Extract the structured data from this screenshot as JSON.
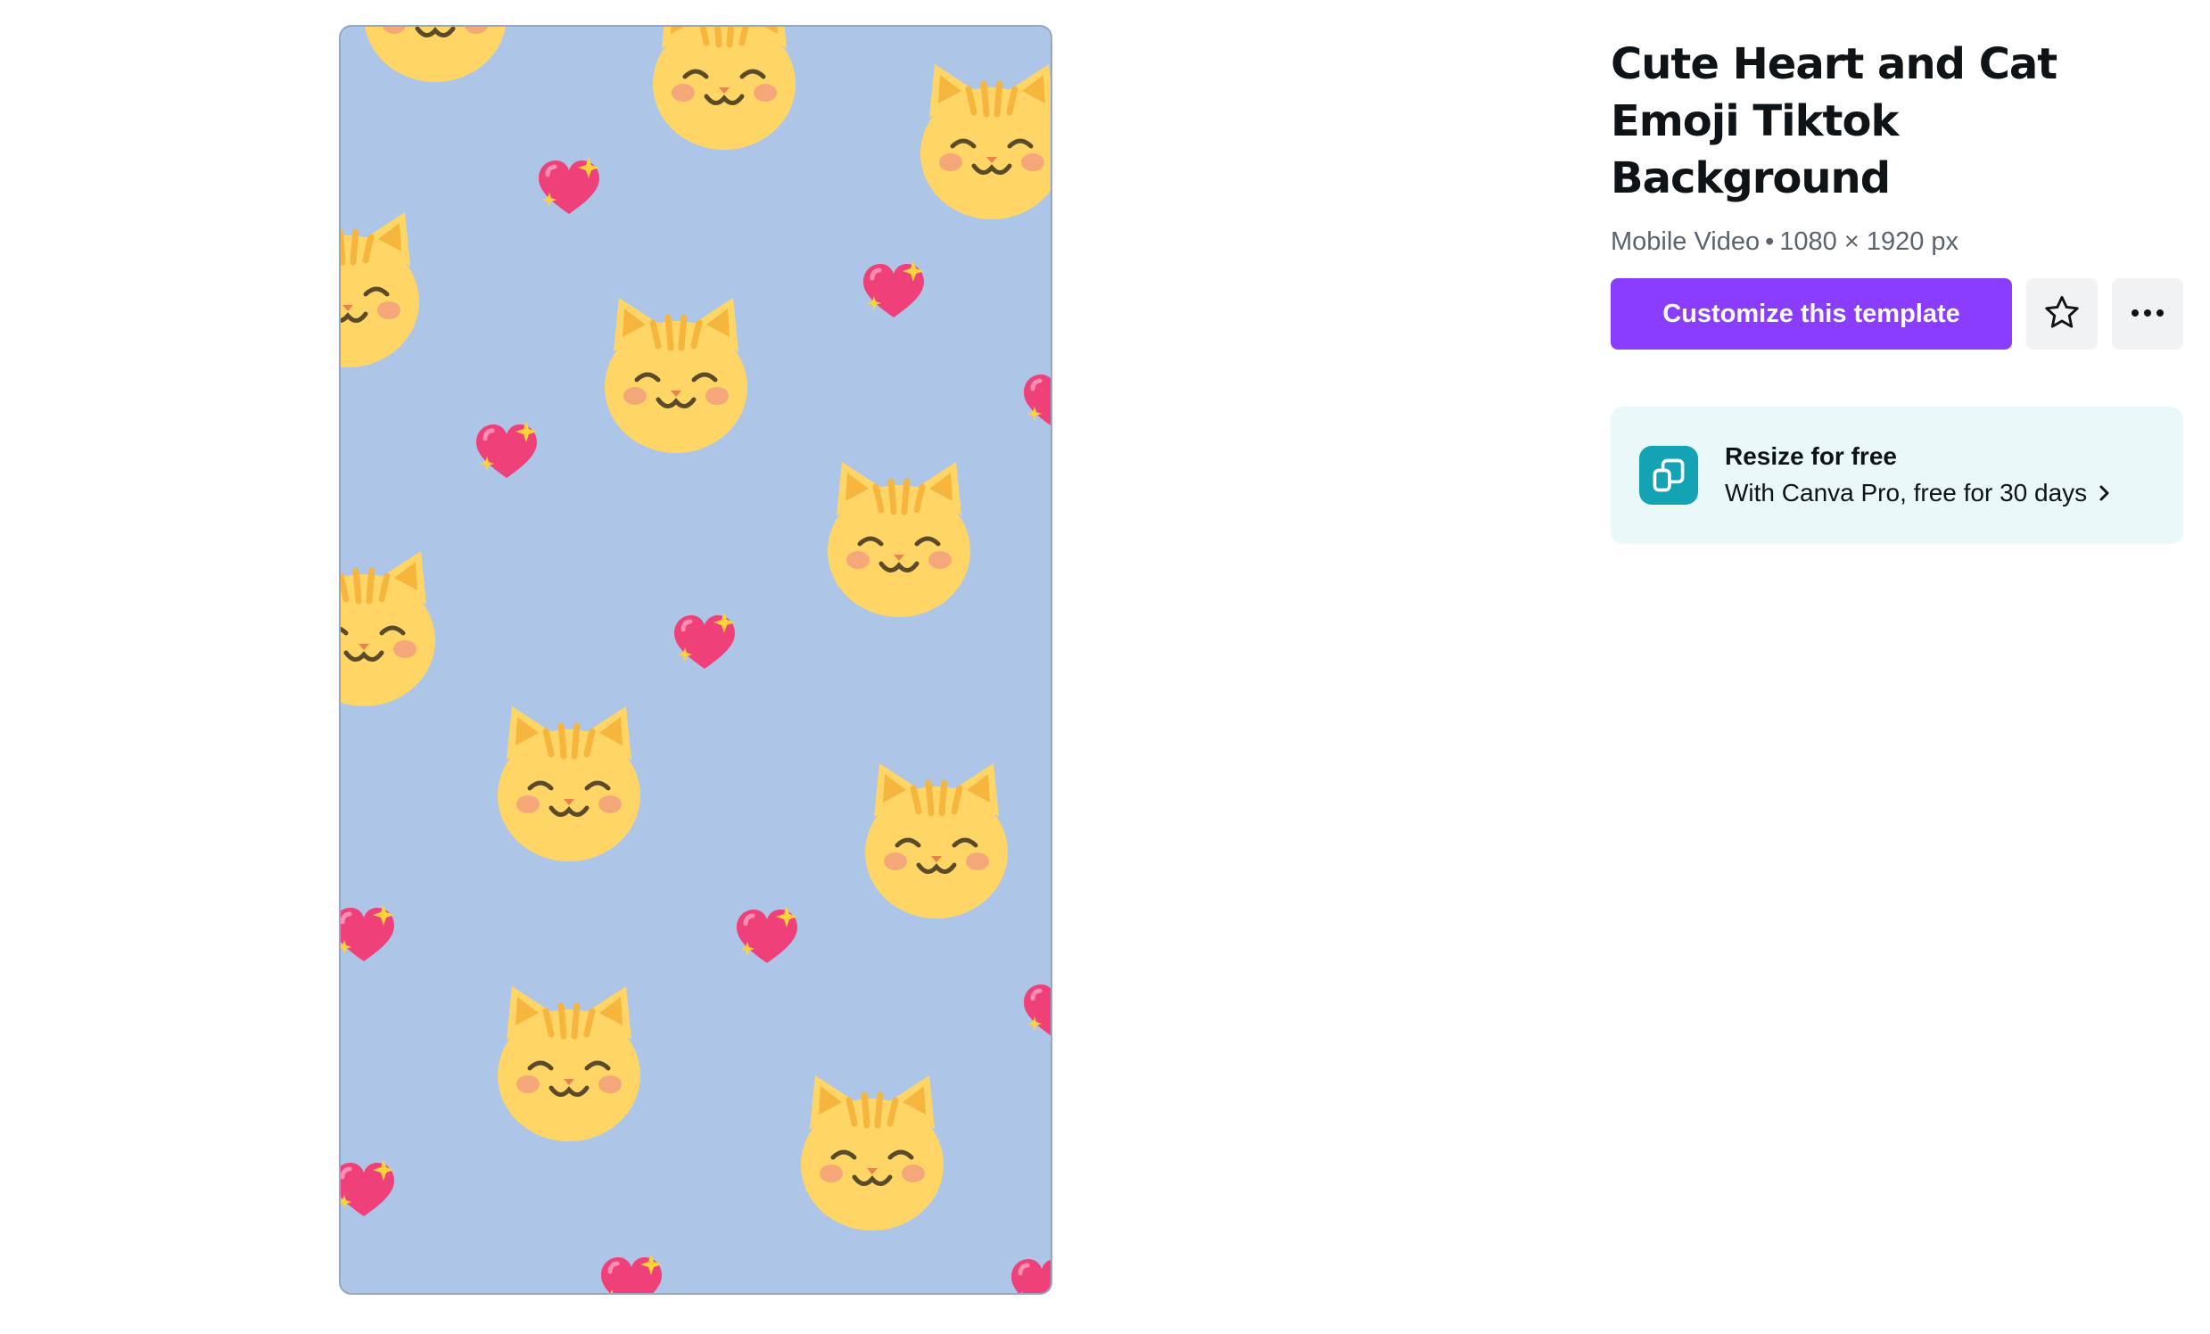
{
  "template": {
    "title": "Cute Heart and Cat Emoji Tiktok Background",
    "format": "Mobile Video",
    "separator": "•",
    "dimensions": "1080 × 1920 px"
  },
  "actions": {
    "customize_label": "Customize this template",
    "favorite_icon": "star-outline-icon",
    "more_icon": "more-horizontal-icon"
  },
  "promo": {
    "icon": "resize-icon",
    "title": "Resize for free",
    "subtitle": "With Canva Pro, free for 30 days"
  },
  "colors": {
    "accent": "#8b3dff",
    "preview_background": "#adc6e8",
    "cat_face": "#ffd666",
    "heart": "#f0407a",
    "promo_background": "#ebf8f9",
    "promo_icon": "#13a3b5"
  }
}
